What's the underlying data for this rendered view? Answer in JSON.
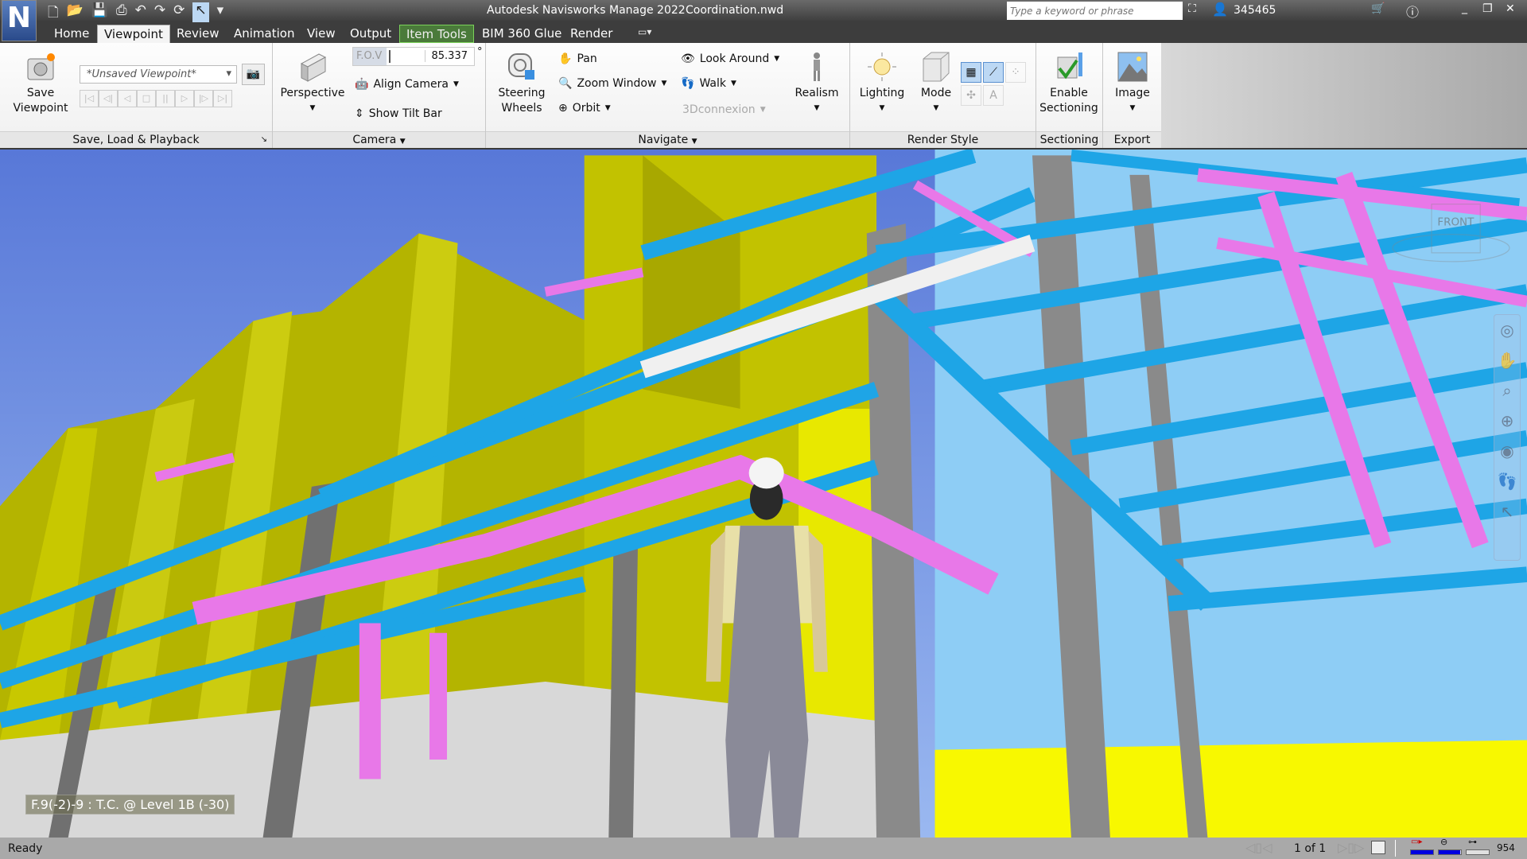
{
  "app": {
    "title": "Autodesk Navisworks Manage 2022",
    "file": "Coordination.nwd",
    "logo_letter": "N",
    "search_placeholder": "Type a keyword or phrase",
    "user": "345465"
  },
  "tabs": [
    {
      "label": "Home"
    },
    {
      "label": "Viewpoint",
      "active": true
    },
    {
      "label": "Review"
    },
    {
      "label": "Animation"
    },
    {
      "label": "View"
    },
    {
      "label": "Output"
    },
    {
      "label": "Item Tools",
      "contextual": true
    },
    {
      "label": "BIM 360 Glue"
    },
    {
      "label": "Render"
    }
  ],
  "ribbon": {
    "save_load": {
      "save_viewpoint": "Save\nViewpoint",
      "save_l1": "Save",
      "save_l2": "Viewpoint",
      "viewpoint_value": "*Unsaved Viewpoint*",
      "panel_label": "Save, Load & Playback"
    },
    "camera": {
      "perspective": "Perspective",
      "fov_label": "F.O.V",
      "fov_value": "85.337",
      "fov_unit": "°",
      "align_camera": "Align Camera",
      "show_tilt_bar": "Show Tilt Bar",
      "panel_label": "Camera"
    },
    "navigate": {
      "steering_l1": "Steering",
      "steering_l2": "Wheels",
      "pan": "Pan",
      "zoom_window": "Zoom Window",
      "orbit": "Orbit",
      "look_around": "Look Around",
      "walk": "Walk",
      "connexion": "3Dconnexion",
      "realism": "Realism",
      "panel_label": "Navigate"
    },
    "render_style": {
      "lighting": "Lighting",
      "mode": "Mode",
      "panel_label": "Render Style"
    },
    "sectioning": {
      "enable_l1": "Enable",
      "enable_l2": "Sectioning",
      "panel_label": "Sectioning"
    },
    "export": {
      "image": "Image",
      "panel_label": "Export"
    }
  },
  "viewport": {
    "location_label": "F.9(-2)-9 : T.C. @ Level 1B (-30)",
    "viewcube_label": "FRONT",
    "colors": {
      "beams": "#1ea5e6",
      "ducts": "#e878e8",
      "walls": "#c2c200",
      "columns": "#8a8a8a"
    }
  },
  "status": {
    "text": "Ready",
    "page": "1 of 1",
    "memory_value": "954",
    "pencil_fill": 1.0,
    "disk_fill": 0.95,
    "network_fill": 0.0
  }
}
